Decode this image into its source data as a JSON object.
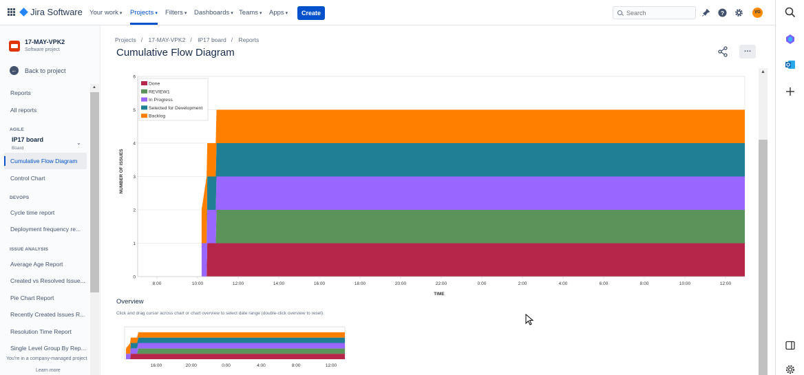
{
  "topnav": {
    "app_name": "Jira Software",
    "items": [
      {
        "label": "Your work"
      },
      {
        "label": "Projects"
      },
      {
        "label": "Filters"
      },
      {
        "label": "Dashboards"
      },
      {
        "label": "Teams"
      },
      {
        "label": "Apps"
      }
    ],
    "create_label": "Create",
    "search_placeholder": "Search",
    "avatar_initials": "VG",
    "accent": "#0052cc"
  },
  "sidebar": {
    "project_name": "17-MAY-VPK2",
    "project_type": "Software project",
    "back_label": "Back to project",
    "reports_heading": "Reports",
    "all_reports": "All reports",
    "agile_heading": "AGILE",
    "board_name": "IP17 board",
    "board_type": "Board",
    "agile_items": [
      "Cumulative Flow Diagram",
      "Control Chart"
    ],
    "devops_heading": "DEVOPS",
    "devops_items": [
      "Cycle time report",
      "Deployment frequency re..."
    ],
    "issue_heading": "ISSUE ANALYSIS",
    "issue_items": [
      "Average Age Report",
      "Created vs Resolved Issue...",
      "Pie Chart Report",
      "Recently Created Issues R...",
      "Resolution Time Report",
      "Single Level Group By Rep..."
    ],
    "company_note": "You're in a company-managed project",
    "learn_more": "Learn more"
  },
  "main": {
    "breadcrumb": [
      "Projects",
      "17-MAY-VPK2",
      "IP17 board",
      "Reports"
    ],
    "title": "Cumulative Flow Diagram",
    "overview_title": "Overview",
    "overview_hint": "Click and drag cursor across chart or chart overview to select date range (double-click overview to reset)."
  },
  "chart_data": {
    "type": "area",
    "stacked": true,
    "ylabel": "NUMBER OF ISSUES",
    "xlabel": "TIME",
    "ylim": [
      0,
      6
    ],
    "yticks": [
      "0",
      "1",
      "2",
      "3",
      "4",
      "5",
      "6"
    ],
    "xticks": [
      "8:00",
      "10:00",
      "12:00",
      "14:00",
      "16:00",
      "18:00",
      "20:00",
      "22:00",
      "0:00",
      "2:00",
      "4:00",
      "6:00",
      "8:00",
      "10:00",
      "12:00"
    ],
    "x": [
      "12:30",
      "13:00",
      "13:04",
      "13:55",
      "14:00"
    ],
    "x_hours": [
      12.5,
      13.0,
      13.07,
      13.92,
      14.0
    ],
    "legend_position": "top-left",
    "series": [
      {
        "name": "Done",
        "color": "#b5264a",
        "values": [
          0,
          0,
          1,
          1,
          1
        ]
      },
      {
        "name": "REVIEW1",
        "color": "#5b935b",
        "values": [
          0,
          0,
          0,
          0,
          1
        ]
      },
      {
        "name": "In Progress",
        "color": "#9966ff",
        "values": [
          1,
          1,
          1,
          1,
          1
        ]
      },
      {
        "name": "Selected for Development",
        "color": "#217f95",
        "values": [
          0,
          0,
          1,
          1,
          1
        ]
      },
      {
        "name": "Backlog",
        "color": "#ff8000",
        "values": [
          1,
          2,
          1,
          1,
          1
        ]
      }
    ],
    "overview_xticks": [
      "16:00",
      "20:00",
      "0:00",
      "4:00",
      "8:00",
      "12:00"
    ]
  }
}
